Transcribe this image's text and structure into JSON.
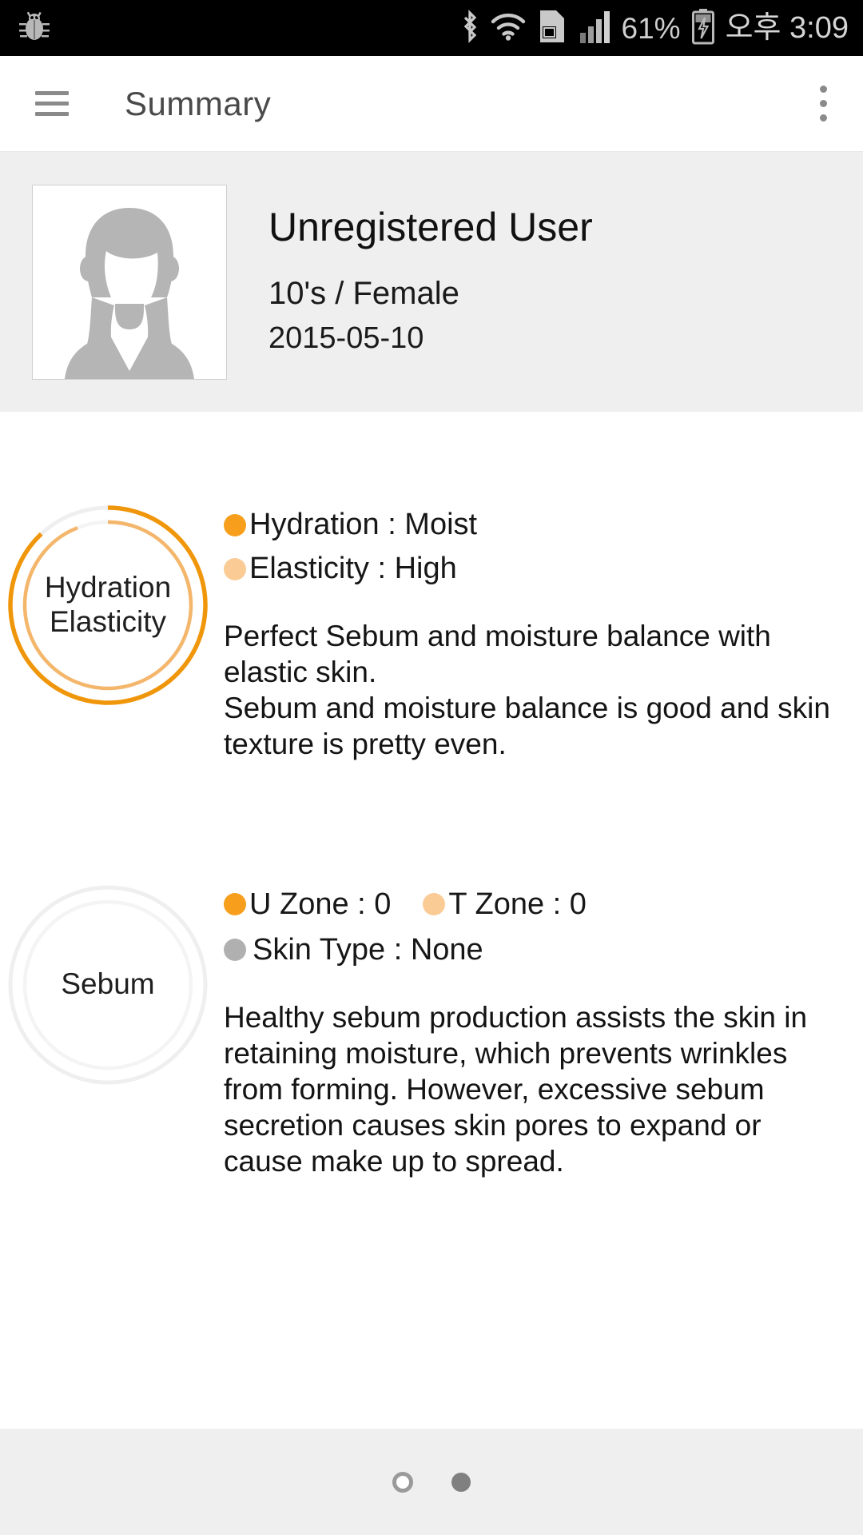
{
  "status_bar": {
    "left_icon": "bug-icon",
    "icons": [
      "bluetooth-icon",
      "wifi-icon",
      "sd-card-alert-icon",
      "signal-bars-icon"
    ],
    "battery_percent": "61%",
    "battery_icon": "battery-charging-icon",
    "time": "오후 3:09"
  },
  "app_bar": {
    "menu_icon": "hamburger-menu-icon",
    "title": "Summary",
    "overflow_icon": "more-vertical-icon"
  },
  "profile": {
    "avatar_icon": "user-placeholder-avatar",
    "name": "Unregistered User",
    "age_gender": "10's / Female",
    "date": "2015-05-10"
  },
  "colors": {
    "primary_orange": "#F5A01E",
    "light_orange": "#FBCB96",
    "gray_dot": "#B0B0B0",
    "track_gray": "#EFEFEF",
    "panel_gray": "#EFEFEF"
  },
  "cards": [
    {
      "id": "hydration-elasticity",
      "ring_label": "Hydration\nElasticity",
      "outer_ring": {
        "name": "hydration-ring",
        "percent": 88,
        "color": "#F0960A",
        "track": "#EFEFEF"
      },
      "inner_ring": {
        "name": "elasticity-ring",
        "percent": 94,
        "color": "#F4B66B",
        "track": "#F4F4F4"
      },
      "legend": [
        {
          "name": "hydration-legend",
          "dot_color": "#F79F1C",
          "text": "Hydration : Moist"
        },
        {
          "name": "elasticity-legend",
          "dot_color": "#FBCB96",
          "text": "Elasticity : High"
        }
      ],
      "description": "Perfect Sebum and moisture balance with elastic skin.\nSebum and moisture balance is good and skin texture is pretty even."
    },
    {
      "id": "sebum",
      "ring_label": "Sebum",
      "outer_ring": {
        "name": "u-zone-ring",
        "percent": 0,
        "color": "#F0960A",
        "track": "#EFEFEF"
      },
      "inner_ring": {
        "name": "t-zone-ring",
        "percent": 0,
        "color": "#F4B66B",
        "track": "#F4F4F4"
      },
      "legend": [
        {
          "name": "u-zone-legend",
          "dot_color": "#F79F1C",
          "text": "U Zone : 0"
        },
        {
          "name": "t-zone-legend",
          "dot_color": "#FBCB96",
          "text": "T Zone : 0"
        },
        {
          "name": "skin-type-legend",
          "dot_color": "#B0B0B0",
          "text": "Skin Type : None"
        }
      ],
      "description": "Healthy sebum production assists the skin in retaining moisture, which prevents wrinkles from forming. However, excessive sebum secretion causes skin pores to expand or cause make up to spread."
    }
  ],
  "footer": {
    "pager": [
      {
        "name": "page-dot-1",
        "state": "inactive"
      },
      {
        "name": "page-dot-2",
        "state": "active"
      }
    ]
  },
  "chart_data": {
    "type": "pie",
    "title": "Skin Analysis Summary Rings",
    "series": [
      {
        "name": "Hydration",
        "value": 88,
        "label": "Moist",
        "color": "#F0960A",
        "ring": "outer",
        "card": "hydration-elasticity"
      },
      {
        "name": "Elasticity",
        "value": 94,
        "label": "High",
        "color": "#F4B66B",
        "ring": "inner",
        "card": "hydration-elasticity"
      },
      {
        "name": "U Zone",
        "value": 0,
        "label": "0",
        "color": "#F0960A",
        "ring": "outer",
        "card": "sebum"
      },
      {
        "name": "T Zone",
        "value": 0,
        "label": "0",
        "color": "#F4B66B",
        "ring": "inner",
        "card": "sebum"
      },
      {
        "name": "Skin Type",
        "value": 0,
        "label": "None",
        "color": "#B0B0B0",
        "ring": "none",
        "card": "sebum"
      }
    ],
    "ylim": [
      0,
      100
    ],
    "grid": false,
    "legend": "right"
  }
}
